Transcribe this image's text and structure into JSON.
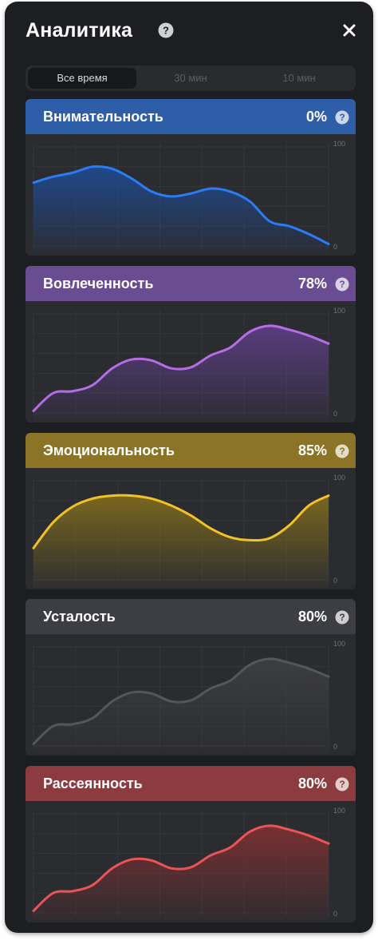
{
  "header": {
    "title": "Аналитика",
    "help_icon": "question-circle-icon",
    "close_icon": "close-x-icon"
  },
  "range_tabs": [
    {
      "label": "Все время",
      "active": true
    },
    {
      "label": "30 мин",
      "active": false
    },
    {
      "label": "10 мин",
      "active": false
    }
  ],
  "metrics": [
    {
      "title": "Внимательность",
      "value": "0%",
      "color": "#2f5ea8",
      "line": "#2a7cf6",
      "fill": "#1f4a8f",
      "chart_data": {
        "type": "area",
        "ylim": [
          0,
          100
        ],
        "ymax_label": "100",
        "ymin_label": "0",
        "values": [
          64,
          70,
          74,
          80,
          78,
          68,
          55,
          50,
          53,
          58,
          55,
          45,
          25,
          20,
          12,
          2
        ]
      }
    },
    {
      "title": "Вовлеченность",
      "value": "78%",
      "color": "#6a4c92",
      "line": "#b46de6",
      "fill": "#5c3d82",
      "chart_data": {
        "type": "area",
        "ylim": [
          0,
          100
        ],
        "ymax_label": "100",
        "ymin_label": "0",
        "values": [
          2,
          20,
          22,
          28,
          45,
          54,
          53,
          45,
          46,
          58,
          66,
          82,
          88,
          84,
          78,
          70
        ]
      }
    },
    {
      "title": "Эмоциональность",
      "value": "85%",
      "color": "#8b7426",
      "line": "#f2c224",
      "fill": "#7e6a1e",
      "chart_data": {
        "type": "area",
        "ylim": [
          0,
          100
        ],
        "ymax_label": "100",
        "ymin_label": "0",
        "values": [
          32,
          58,
          74,
          82,
          85,
          85,
          82,
          75,
          65,
          52,
          43,
          40,
          42,
          55,
          75,
          85
        ]
      }
    },
    {
      "title": "Усталость",
      "value": "80%",
      "color": "#3d3e43",
      "line": "#55565b",
      "fill": "#3d3e42",
      "chart_data": {
        "type": "area",
        "ylim": [
          0,
          100
        ],
        "ymax_label": "100",
        "ymin_label": "0",
        "values": [
          2,
          20,
          22,
          28,
          45,
          54,
          53,
          45,
          46,
          58,
          66,
          82,
          88,
          84,
          78,
          70
        ]
      }
    },
    {
      "title": "Рассеянность",
      "value": "80%",
      "color": "#8c3b3e",
      "line": "#ec5356",
      "fill": "#7c3032",
      "chart_data": {
        "type": "area",
        "ylim": [
          0,
          100
        ],
        "ymax_label": "100",
        "ymin_label": "0",
        "values": [
          2,
          20,
          22,
          28,
          45,
          54,
          53,
          45,
          46,
          58,
          66,
          82,
          88,
          84,
          78,
          70
        ]
      }
    }
  ]
}
